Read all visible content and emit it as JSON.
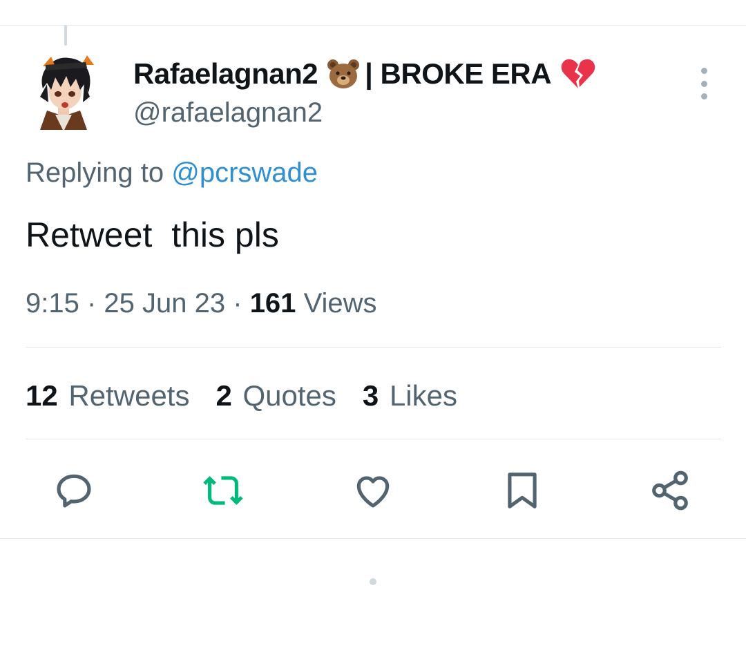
{
  "user": {
    "display_name": "Rafaelagnan2",
    "name_suffix": "| BROKE ERA",
    "bear_emoji": "bear-emoji",
    "heart_emoji": "broken-heart-emoji",
    "handle": "@rafaelagnan2"
  },
  "reply": {
    "prefix": "Replying to",
    "mention": "@pcrswade"
  },
  "tweet": {
    "text": "Retweet  this pls",
    "time": "9:15",
    "date": "25 Jun 23",
    "views_count": "161",
    "views_label": "Views"
  },
  "stats": {
    "retweets_count": "12",
    "retweets_label": "Retweets",
    "quotes_count": "2",
    "quotes_label": "Quotes",
    "likes_count": "3",
    "likes_label": "Likes"
  },
  "actions": [
    {
      "icon": "reply-icon"
    },
    {
      "icon": "retweet-icon",
      "color": "#00ba7c"
    },
    {
      "icon": "like-icon"
    },
    {
      "icon": "bookmark-icon"
    },
    {
      "icon": "share-icon"
    }
  ],
  "colors": {
    "text": "#0f1419",
    "secondary": "#536471",
    "link": "#1d9bf0",
    "retweet_active": "#00ba7c"
  }
}
